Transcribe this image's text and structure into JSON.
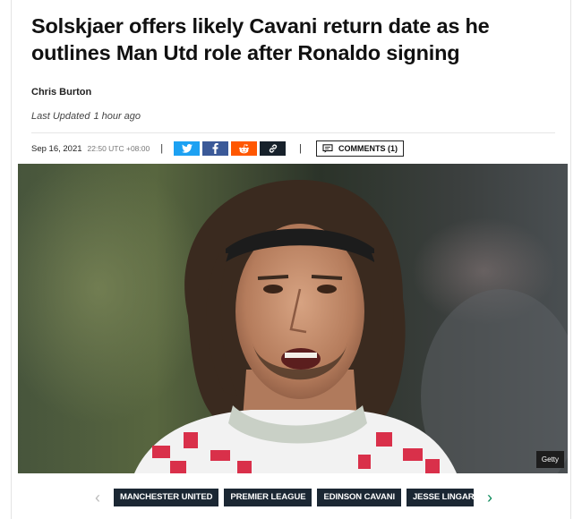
{
  "article": {
    "headline": "Solskjaer offers likely Cavani return date as he outlines Man Utd role after Ronaldo signing",
    "author": "Chris Burton",
    "updated_label": "Last Updated",
    "updated_time": "1 hour ago",
    "date": "Sep 16, 2021",
    "time": "22:50 UTC +08:00",
    "separator": "|"
  },
  "share": {
    "buttons": [
      {
        "name": "twitter",
        "icon": "twitter-icon",
        "color": "#1da1f2"
      },
      {
        "name": "facebook",
        "icon": "facebook-icon",
        "color": "#3b5998"
      },
      {
        "name": "reddit",
        "icon": "reddit-icon",
        "color": "#ff5700"
      },
      {
        "name": "copy-link",
        "icon": "link-icon",
        "color": "#17212b"
      }
    ]
  },
  "comments": {
    "label": "COMMENTS (1)",
    "icon": "comment-icon"
  },
  "image": {
    "credit": "Getty",
    "subject": "player-photo"
  },
  "tags": {
    "items": [
      "MANCHESTER UNITED",
      "PREMIER LEAGUE",
      "EDINSON CAVANI",
      "JESSE LINGARD"
    ],
    "prev_icon": "chevron-left-icon",
    "next_icon": "chevron-right-icon",
    "prev_label": "‹",
    "next_label": "›"
  }
}
